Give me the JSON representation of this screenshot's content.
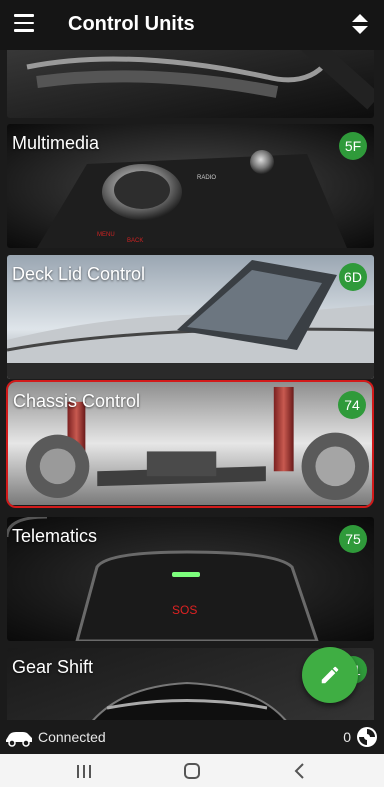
{
  "app": {
    "title": "Control Units",
    "accent": "#2f9a3a",
    "fab_color": "#3fae43"
  },
  "units": [
    {
      "label": "Multimedia",
      "code": "5F",
      "selected": false
    },
    {
      "label": "Deck Lid Control",
      "code": "6D",
      "selected": false
    },
    {
      "label": "Chassis Control",
      "code": "74",
      "selected": true
    },
    {
      "label": "Telematics",
      "code": "75",
      "selected": false
    },
    {
      "label": "Gear Shift",
      "code": "81",
      "selected": false
    }
  ],
  "status": {
    "connection": "Connected",
    "count": "0"
  },
  "icons": {
    "menu": "hamburger-menu-icon",
    "sort": "sort-icon",
    "fab": "pencil-icon",
    "car": "car-icon",
    "status": "spinner-icon"
  }
}
